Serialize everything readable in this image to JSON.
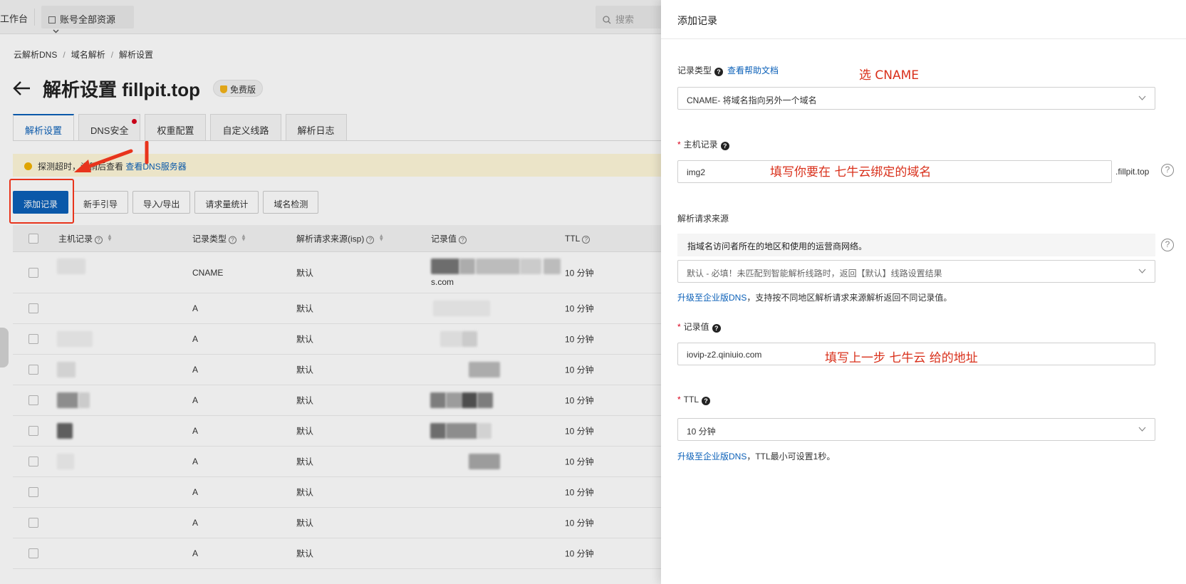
{
  "topbar": {
    "workbench": "工作台",
    "resource": "账号全部资源",
    "search_placeholder": "搜索"
  },
  "breadcrumb": [
    "云解析DNS",
    "域名解析",
    "解析设置"
  ],
  "page": {
    "title": "解析设置 fillpit.top",
    "badge": "免费版"
  },
  "tabs": [
    {
      "label": "解析设置",
      "active": true
    },
    {
      "label": "DNS安全",
      "dot": true
    },
    {
      "label": "权重配置"
    },
    {
      "label": "自定义线路"
    },
    {
      "label": "解析日志"
    }
  ],
  "notice": {
    "text": "探测超时，请稍后查看",
    "link": "查看DNS服务器"
  },
  "actions": [
    "添加记录",
    "新手引导",
    "导入/导出",
    "请求量统计",
    "域名检测"
  ],
  "table": {
    "headers": [
      "主机记录",
      "记录类型",
      "解析请求来源(isp)",
      "记录值",
      "TTL"
    ],
    "rows": [
      {
        "type": "CNAME",
        "isp": "默认",
        "value_suffix": "s.com",
        "ttl": "10 分钟"
      },
      {
        "type": "A",
        "isp": "默认",
        "ttl": "10 分钟"
      },
      {
        "type": "A",
        "isp": "默认",
        "ttl": "10 分钟"
      },
      {
        "type": "A",
        "isp": "默认",
        "ttl": "10 分钟"
      },
      {
        "type": "A",
        "isp": "默认",
        "ttl": "10 分钟"
      },
      {
        "type": "A",
        "isp": "默认",
        "ttl": "10 分钟"
      },
      {
        "type": "A",
        "isp": "默认",
        "ttl": "10 分钟"
      },
      {
        "type": "A",
        "isp": "默认",
        "ttl": "10 分钟"
      },
      {
        "type": "A",
        "isp": "默认",
        "ttl": "10 分钟"
      },
      {
        "type": "A",
        "isp": "默认",
        "ttl": "10 分钟"
      }
    ]
  },
  "drawer": {
    "title": "添加记录",
    "record_type": {
      "label": "记录类型",
      "help_link": "查看帮助文档",
      "value": "CNAME- 将域名指向另外一个域名"
    },
    "host": {
      "label": "主机记录",
      "value": "img2",
      "suffix": ".fillpit.top"
    },
    "isp": {
      "label": "解析请求来源",
      "info": "指域名访问者所在的地区和使用的运营商网络。",
      "value": "默认 - 必填！未匹配到智能解析线路时，返回【默认】线路设置结果",
      "hint_link": "升级至企业版DNS",
      "hint_text": "，支持按不同地区解析请求来源解析返回不同记录值。"
    },
    "value": {
      "label": "记录值",
      "value": "iovip-z2.qiniuio.com"
    },
    "ttl": {
      "label": "TTL",
      "value": "10 分钟",
      "hint_link": "升级至企业版DNS",
      "hint_text": "，TTL最小可设置1秒。"
    }
  },
  "annotations": {
    "type_note": "选 CNAME",
    "host_note": "填写你要在 七牛云绑定的域名",
    "value_note": "填写上一步 七牛云 给的地址"
  },
  "colors": {
    "primary": "#0b60b8",
    "annotation": "#d9301b",
    "required": "#d9001b"
  }
}
